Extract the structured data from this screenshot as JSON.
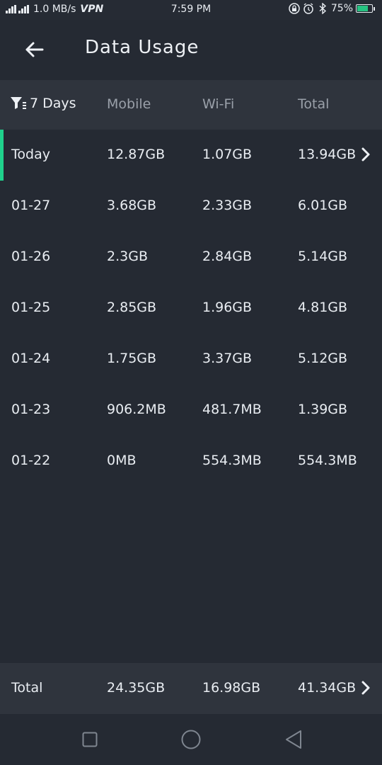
{
  "status_bar": {
    "speed": "1.0 MB/s",
    "vpn": "VPN",
    "time": "7:59 PM",
    "battery": "75%",
    "battery_level": 0.75,
    "icons": [
      "signal-icon",
      "lock-icon",
      "alarm-icon",
      "bluetooth-icon",
      "battery-icon"
    ]
  },
  "appbar": {
    "title": "Data Usage",
    "back_icon": "back-arrow-icon"
  },
  "header": {
    "filter": "7 Days",
    "filter_icon": "filter-icon",
    "columns": [
      "Mobile",
      "Wi-Fi",
      "Total"
    ]
  },
  "rows": [
    {
      "date": "Today",
      "mobile": "12.87GB",
      "wifi": "1.07GB",
      "total": "13.94GB",
      "active": true
    },
    {
      "date": "01-27",
      "mobile": "3.68GB",
      "wifi": "2.33GB",
      "total": "6.01GB"
    },
    {
      "date": "01-26",
      "mobile": "2.3GB",
      "wifi": "2.84GB",
      "total": "5.14GB"
    },
    {
      "date": "01-25",
      "mobile": "2.85GB",
      "wifi": "1.96GB",
      "total": "4.81GB"
    },
    {
      "date": "01-24",
      "mobile": "1.75GB",
      "wifi": "3.37GB",
      "total": "5.12GB"
    },
    {
      "date": "01-23",
      "mobile": "906.2MB",
      "wifi": "481.7MB",
      "total": "1.39GB"
    },
    {
      "date": "01-22",
      "mobile": "0MB",
      "wifi": "554.3MB",
      "total": "554.3MB"
    }
  ],
  "total": {
    "label": "Total",
    "mobile": "24.35GB",
    "wifi": "16.98GB",
    "total": "41.34GB"
  },
  "colors": {
    "accent": "#1fd18c",
    "background": "#252a33",
    "header": "#2f343d",
    "battery": "#26c281"
  }
}
